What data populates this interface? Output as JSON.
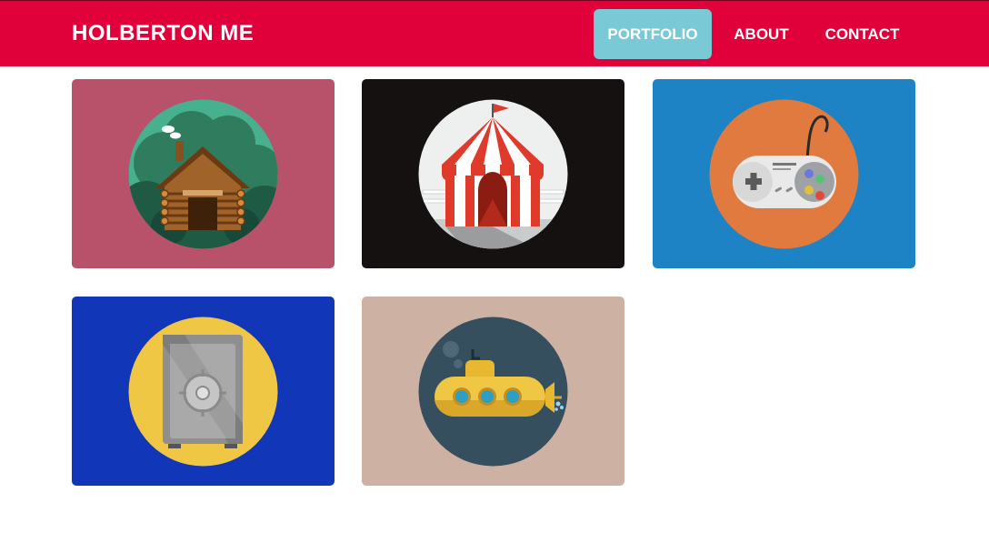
{
  "navbar": {
    "brand": "HOLBERTON ME",
    "links": [
      {
        "label": "PORTFOLIO",
        "active": true
      },
      {
        "label": "ABOUT",
        "active": false
      },
      {
        "label": "CONTACT",
        "active": false
      }
    ],
    "background_color": "#e0003a",
    "active_color": "#79c9d6"
  },
  "portfolio": {
    "items": [
      {
        "icon": "log-cabin-icon",
        "background_color": "#b8516a",
        "circle_color": "#47b08f"
      },
      {
        "icon": "circus-tent-icon",
        "background_color": "#141110",
        "circle_color": "#eef0f0"
      },
      {
        "icon": "game-controller-icon",
        "background_color": "#1e83c4",
        "circle_color": "#e07a3f"
      },
      {
        "icon": "safe-icon",
        "background_color": "#1236b8",
        "circle_color": "#f0c645"
      },
      {
        "icon": "submarine-icon",
        "background_color": "#cdb2a4",
        "circle_color": "#364f5e"
      }
    ]
  }
}
